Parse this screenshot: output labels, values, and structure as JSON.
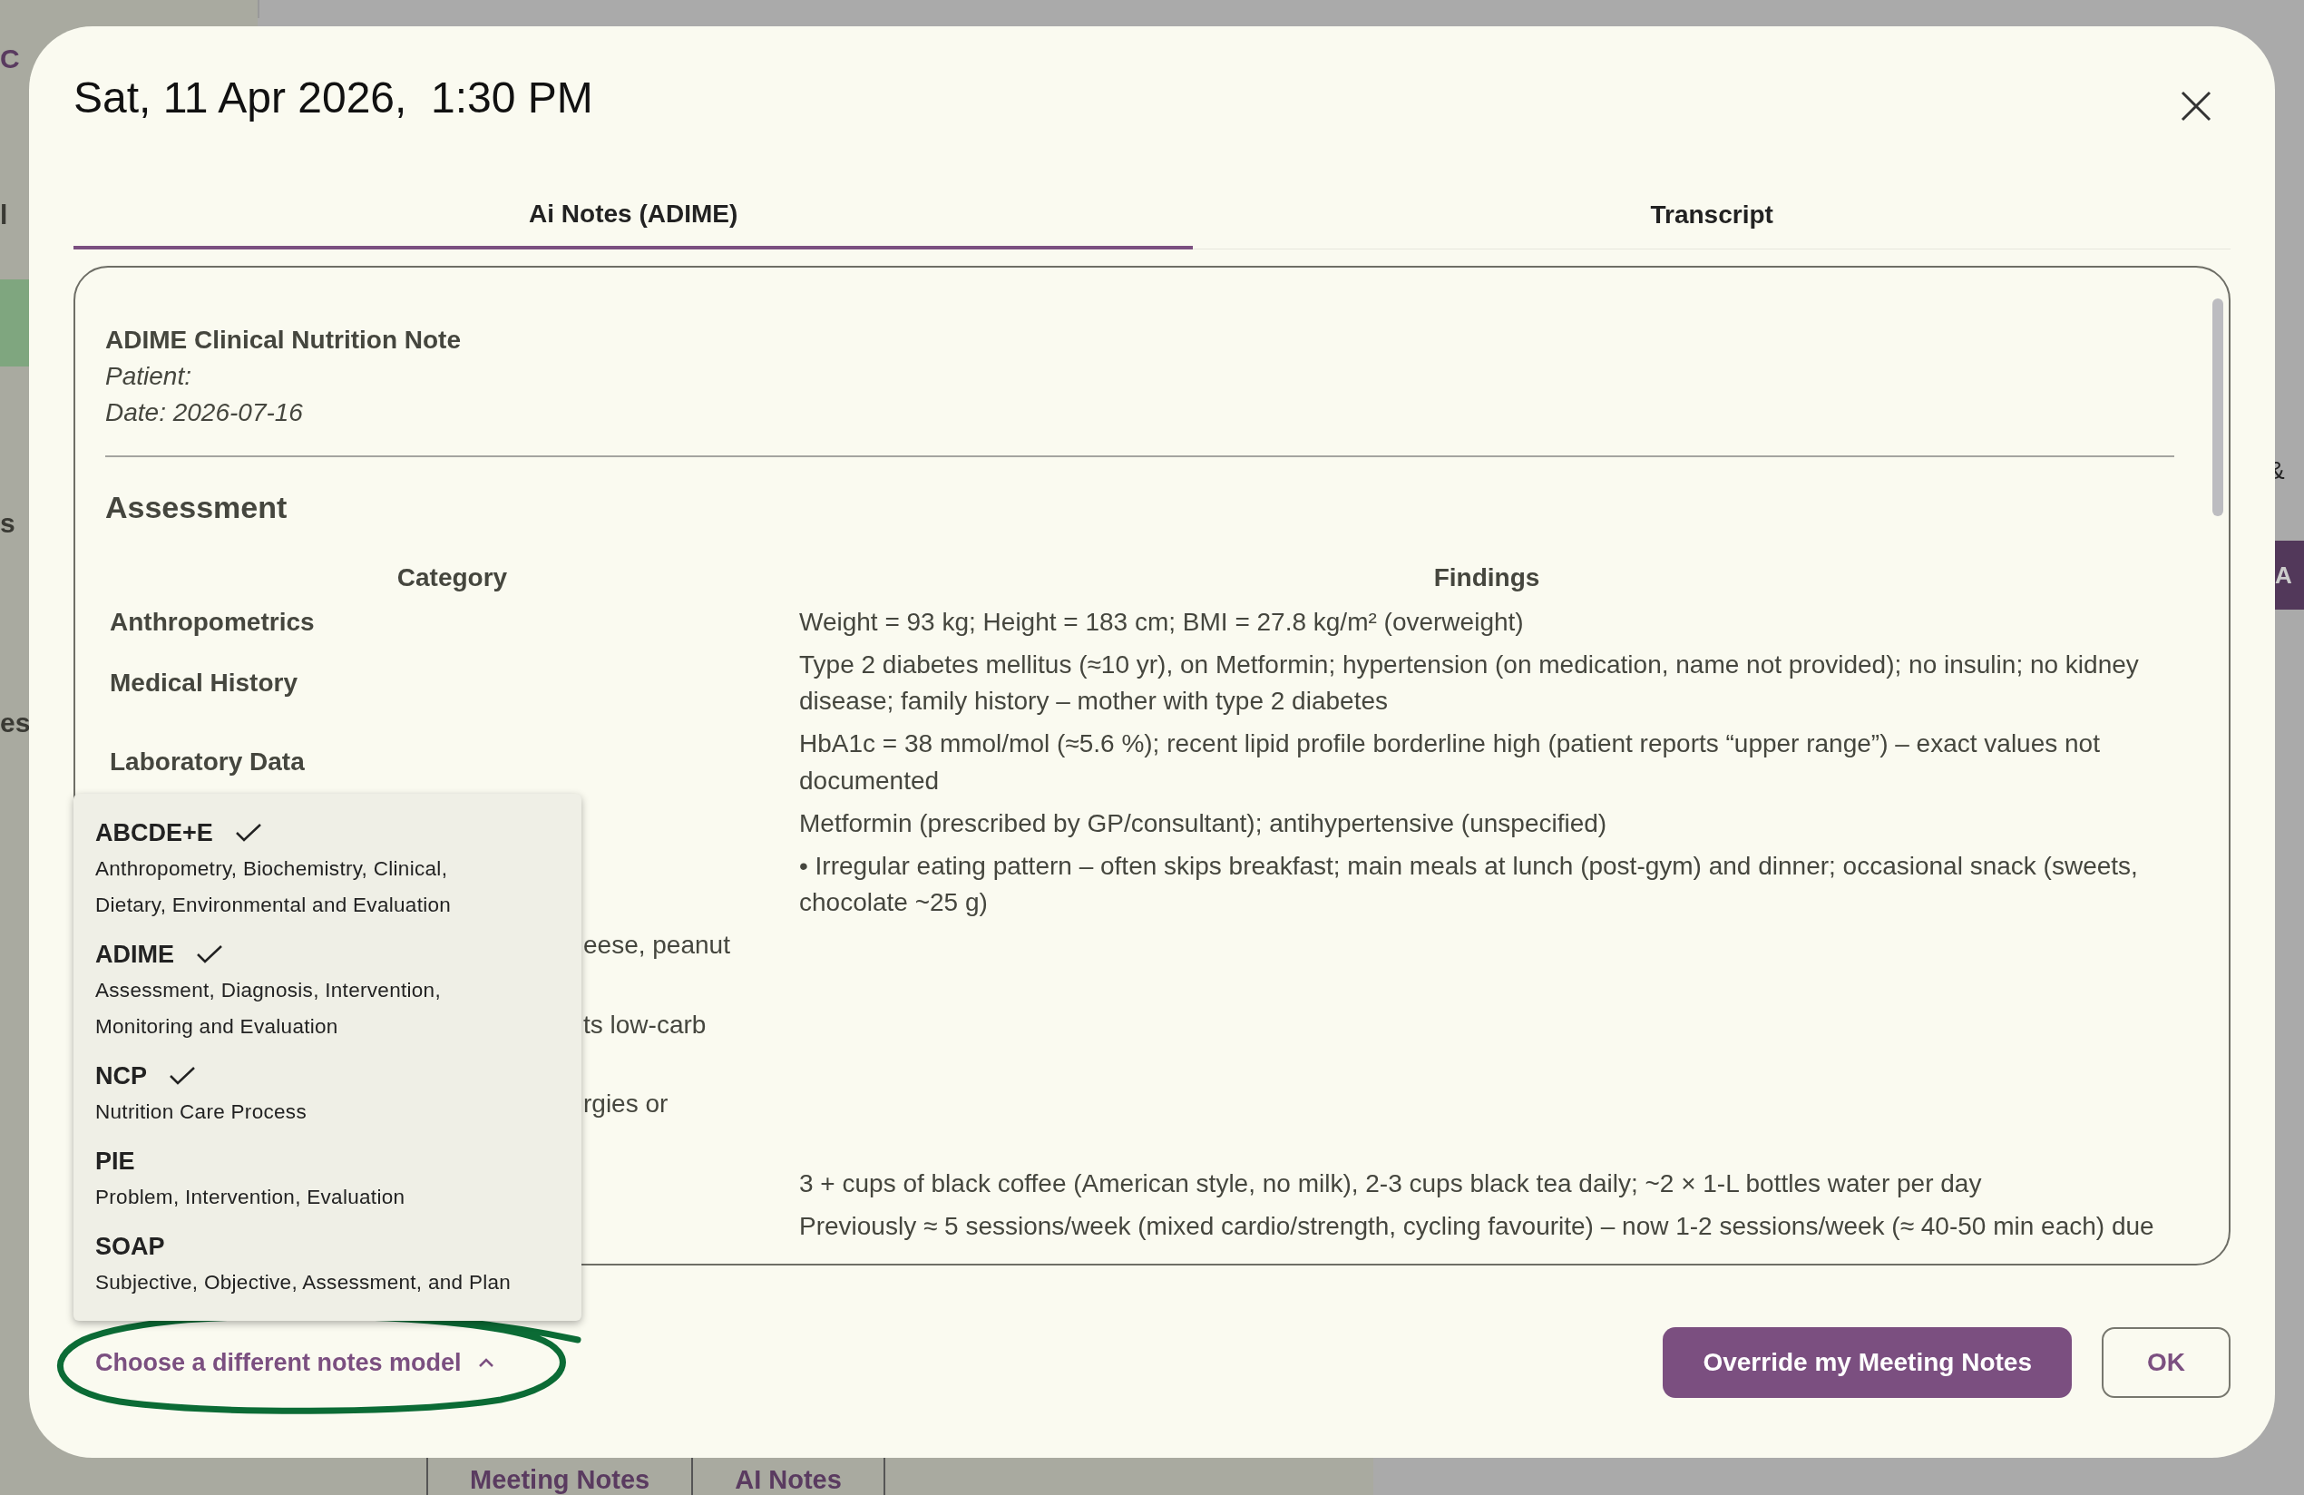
{
  "background_page": {
    "left_labels": [
      "C",
      "l",
      "s",
      "es"
    ],
    "right_label": "&",
    "right_button": "A",
    "bottom_tabs": [
      "Meeting Notes",
      "AI Notes"
    ]
  },
  "dialog": {
    "title": "Sat, 11 Apr 2026,  1:30 PM",
    "tabs": [
      {
        "label": "Ai Notes (ADIME)",
        "selected": true
      },
      {
        "label": "Transcript",
        "selected": false
      }
    ],
    "note": {
      "title": "ADIME Clinical Nutrition Note",
      "meta": [
        "Patient:",
        "Date: 2026-07-16"
      ],
      "section": "Assessment",
      "columns": [
        "Category",
        "Findings"
      ],
      "rows": [
        {
          "category": "Anthropometrics",
          "covered": false,
          "findings": [
            "Weight = 93 kg; Height = 183 cm; BMI = 27.8 kg/m² (overweight)"
          ]
        },
        {
          "category": "Medical History",
          "covered": false,
          "findings": [
            "Type 2 diabetes mellitus (≈10 yr), on Metformin; hypertension (on medication, name not provided); no insulin; no kidney",
            "disease; family history – mother with type 2 diabetes"
          ]
        },
        {
          "category": "Laboratory Data",
          "covered": false,
          "findings": [
            "HbA1c = 38 mmol/mol (≈5.6 %); recent lipid profile borderline high (patient reports “upper range”) – exact values not",
            "documented"
          ]
        },
        {
          "findings": [
            "Metformin (prescribed by GP/consultant); antihypertensive (unspecified)"
          ]
        },
        {
          "findings": [
            "• Irregular eating pattern – often skips breakfast; main meals at lunch (post-gym) and dinner; occasional snack (sweets,",
            "chocolate ~25 g)"
          ]
        },
        {
          "category": "eese, peanut",
          "covered": true
        },
        {
          "category": "ts low-carb",
          "covered": true
        },
        {
          "category": "rgies or",
          "covered": true
        },
        {
          "findings": [
            "3 + cups of black coffee (American style, no milk), 2-3 cups black tea daily; ~2 × 1-L bottles water per day"
          ]
        },
        {
          "findings": [
            "Previously ≈ 5 sessions/week (mixed cardio/strength, cycling favourite) – now 1-2 sessions/week (≈ 40-50 min each) due"
          ]
        }
      ]
    },
    "models_menu": [
      {
        "name": "ABCDE+E",
        "description": "Anthropometry, Biochemistry, Clinical, Dietary, Environmental and Evaluation",
        "checked": true
      },
      {
        "name": "ADIME",
        "description": "Assessment, Diagnosis, Intervention, Monitoring and Evaluation",
        "checked": true
      },
      {
        "name": "NCP",
        "description": "Nutrition Care Process",
        "checked": true
      },
      {
        "name": "PIE",
        "description": "Problem, Intervention, Evaluation",
        "checked": false
      },
      {
        "name": "SOAP",
        "description": "Subjective, Objective, Assessment, and Plan",
        "checked": false
      }
    ],
    "model_link": {
      "label": "Choose a different notes model",
      "expanded": true
    },
    "buttons": [
      {
        "label": "Override my Meeting Notes",
        "kind": "primary"
      },
      {
        "label": "OK",
        "kind": "outlined"
      }
    ]
  }
}
